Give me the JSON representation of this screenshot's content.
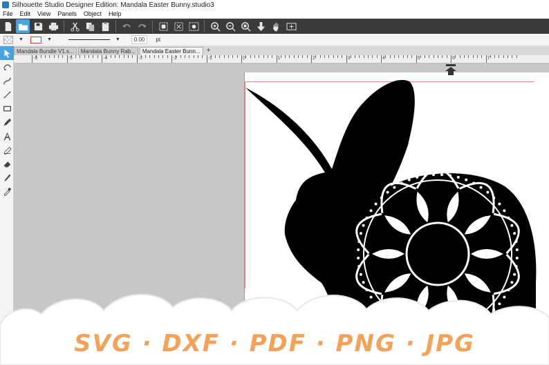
{
  "window": {
    "title": "Silhouette Studio Designer Edition: Mandala Easter Bunny.studio3"
  },
  "menu": [
    "File",
    "Edit",
    "View",
    "Panels",
    "Object",
    "Help"
  ],
  "toolbar": {
    "buttons": [
      "new-doc-icon",
      "open-folder-icon",
      "save-icon",
      "print-icon",
      "cut-icon",
      "copy-icon",
      "paste-icon",
      "undo-icon",
      "redo-icon",
      "group-icon",
      "ungroup-icon",
      "select-all-icon",
      "zoom-in-icon",
      "zoom-out-icon",
      "zoom-fit-icon",
      "move-down-icon",
      "pan-hand-icon",
      "fit-page-icon"
    ]
  },
  "line_settings": {
    "stroke_width": "0.00",
    "unit": "pt",
    "stroke_color": "#d33333"
  },
  "tabs": [
    {
      "label": "Mandala Bundle V1.s...",
      "active": false
    },
    {
      "label": "Mandala Bunny Rab...",
      "active": false
    },
    {
      "label": "Mandala Easter Bunn...",
      "active": true
    }
  ],
  "tab_add": "+",
  "ruler": {
    "labels": [
      "-6",
      "-5",
      "-4",
      "-3",
      "-2",
      "-1",
      "0",
      "1",
      "2",
      "3",
      "4",
      "5",
      "6",
      "7"
    ]
  },
  "tools": [
    "select-arrow-icon",
    "point-edit-icon",
    "curve-icon",
    "line-icon",
    "rectangle-icon",
    "pencil-icon",
    "text-icon",
    "fill-icon",
    "eraser-icon",
    "knife-icon",
    "eyedropper-icon"
  ],
  "banner": {
    "text": "SVG · DXF · PDF · PNG · JPG"
  },
  "colors": {
    "accent": "#4aa3df",
    "toolbar_bg": "#3a3a3a",
    "canvas_bg": "#c7c7c7",
    "banner_text": "#f2a25b"
  }
}
